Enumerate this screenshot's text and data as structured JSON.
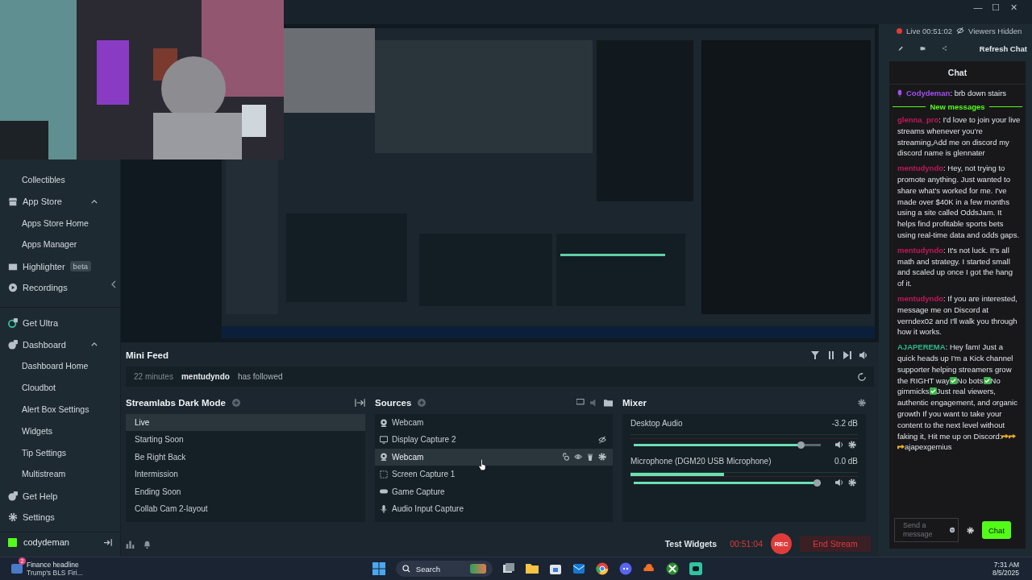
{
  "window": {
    "controls": [
      "—",
      "☐",
      "✕"
    ]
  },
  "sidebar": {
    "groups": [
      {
        "items": [
          {
            "kind": "sub",
            "label": "Collectibles"
          },
          {
            "kind": "section",
            "label": "App Store",
            "expanded": true,
            "children": [
              {
                "label": "Apps Store Home"
              },
              {
                "label": "Apps Manager"
              }
            ]
          },
          {
            "kind": "section",
            "label": "Highlighter",
            "badge": "beta"
          },
          {
            "kind": "section",
            "label": "Recordings"
          }
        ]
      },
      {
        "items": [
          {
            "kind": "section",
            "label": "Get Ultra"
          },
          {
            "kind": "section",
            "label": "Dashboard",
            "expanded": true,
            "children": [
              {
                "label": "Dashboard Home"
              },
              {
                "label": "Cloudbot"
              },
              {
                "label": "Alert Box Settings"
              },
              {
                "label": "Widgets"
              },
              {
                "label": "Tip Settings"
              },
              {
                "label": "Multistream"
              }
            ]
          },
          {
            "kind": "section",
            "label": "Get Help"
          },
          {
            "kind": "section",
            "label": "Settings"
          }
        ]
      }
    ],
    "user": "codydeman"
  },
  "mini_feed": {
    "title": "Mini Feed",
    "events": [
      {
        "time": "22 minutes",
        "user": "mentudyndo",
        "action": "has followed"
      }
    ]
  },
  "scenes": {
    "collection": "Streamlabs Dark Mode",
    "items": [
      {
        "label": "Live",
        "selected": true
      },
      {
        "label": "Starting Soon",
        "selected": false
      },
      {
        "label": "Be Right Back",
        "selected": false
      },
      {
        "label": "Intermission",
        "selected": false
      },
      {
        "label": "Ending Soon",
        "selected": false
      },
      {
        "label": "Collab Cam 2-layout",
        "selected": false
      }
    ]
  },
  "sources": {
    "title": "Sources",
    "items": [
      {
        "kind": "webcam",
        "label": "Webcam",
        "selected": false,
        "hidden": false
      },
      {
        "kind": "display",
        "label": "Display Capture 2",
        "selected": false,
        "hidden": true
      },
      {
        "kind": "webcam",
        "label": "Webcam",
        "selected": true,
        "hidden": false
      },
      {
        "kind": "screen",
        "label": "Screen Capture 1",
        "selected": false,
        "hidden": false
      },
      {
        "kind": "game",
        "label": "Game Capture",
        "selected": false,
        "hidden": false
      },
      {
        "kind": "audio",
        "label": "Audio Input Capture",
        "selected": false,
        "hidden": false
      }
    ]
  },
  "mixer": {
    "title": "Mixer",
    "channels": [
      {
        "name": "Desktop Audio",
        "reading": "-3.2 dB",
        "volume": {
          "level": 0.91
        }
      },
      {
        "name": "Microphone (DGM20 USB Microphone)",
        "reading": "0.0 dB",
        "meter": {
          "level": 0.41
        },
        "volume": {
          "level": 1
        }
      }
    ]
  },
  "footer": {
    "test_widgets": "Test Widgets",
    "timer": "00:51:04",
    "rec": "REC",
    "end_stream": "End Stream"
  },
  "stream_status": {
    "live": "Live 00:51:02",
    "viewers": "Viewers Hidden",
    "refresh": "Refresh Chat"
  },
  "chat": {
    "title": "Chat",
    "pinned": {
      "user": "Codydeman",
      "text": ": brb down stairs"
    },
    "divider": "New messages",
    "messages": [
      {
        "user": "glenna_pro",
        "color": "#c2185b",
        "parts": [
          {
            "kind": "text",
            "text": ": I'd love to join your live streams whenever you're streaming,Add me on discord my discord name is glennater"
          }
        ]
      },
      {
        "user": "mentudyndo",
        "color": "#c2185b",
        "parts": [
          {
            "kind": "text",
            "text": ": Hey, not trying to promote anything. Just wanted to share what's worked for me. I've made over $40K in a few months using a site called OddsJam. It helps find profitable sports bets using real-time data and odds gaps."
          }
        ]
      },
      {
        "user": "mentudyndo",
        "color": "#c2185b",
        "parts": [
          {
            "kind": "text",
            "text": ": It's not luck. It's all math and strategy. I started small and scaled up once I got the hang of it."
          }
        ]
      },
      {
        "user": "mentudyndo",
        "color": "#c2185b",
        "parts": [
          {
            "kind": "text",
            "text": ": If you are interested, message me on Discord at verndex02 and I'll walk you through how it works."
          }
        ]
      },
      {
        "user": "AJAPEREMA",
        "color": "#2bb98a",
        "parts": [
          {
            "kind": "text",
            "text": ": Hey fam! Just a quick heads up I'm a Kick channel supporter helping streamers grow the RIGHT way"
          },
          {
            "kind": "check"
          },
          {
            "kind": "text",
            "text": "No bots"
          },
          {
            "kind": "check"
          },
          {
            "kind": "text",
            "text": "No gimmicks"
          },
          {
            "kind": "check"
          },
          {
            "kind": "text",
            "text": "Just real viewers, authentic engagement, and organic growth If you want to take your content to the next level without faking it, Hit me up on Discord:"
          },
          {
            "kind": "point"
          },
          {
            "kind": "point"
          },
          {
            "kind": "point"
          },
          {
            "kind": "text",
            "text": "ajapexgemius"
          }
        ]
      }
    ],
    "input": {
      "placeholder": "Send a message"
    },
    "send": "Chat"
  },
  "taskbar": {
    "widget": {
      "badge": "2",
      "title": "Finance headline",
      "subtitle": "Trump's BLS Firi..."
    },
    "search": {
      "placeholder": "Search"
    },
    "time": "7:31 AM",
    "date": "8/5/2025"
  }
}
